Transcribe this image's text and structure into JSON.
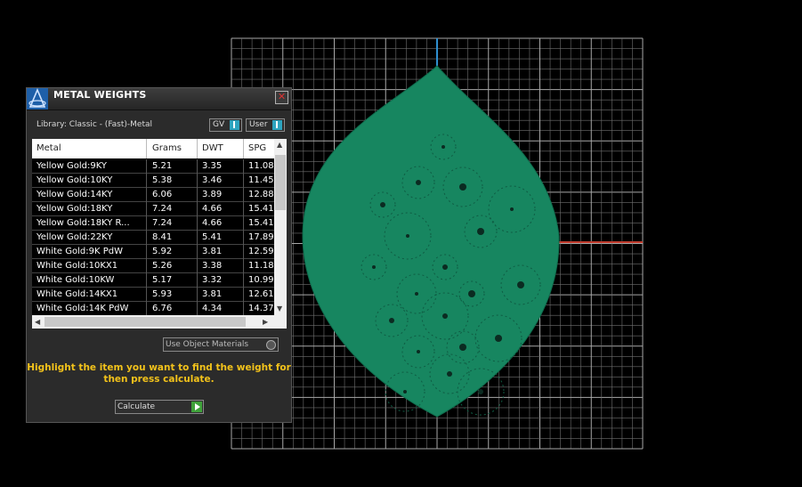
{
  "colors": {
    "background": "#000000",
    "grid": "#8f8f8f",
    "model": "#178660",
    "axis_y": "#2f8fcf",
    "axis_x": "#c0392b",
    "instruction": "#f2c21b",
    "toggle_knob": "#2da4bf",
    "calculate_go": "#3fa13a"
  },
  "panel": {
    "title": "METAL WEIGHTS",
    "close_icon": "close-icon",
    "logo_icon": "app-logo-icon",
    "library_label": "Library: Classic - (Fast)-Metal",
    "toggle_gv": "GV",
    "toggle_user": "User",
    "use_object_materials": "Use Object Materials",
    "instruction": "Highlight the item you want to find the weight for then press calculate.",
    "calculate_label": "Calculate"
  },
  "table": {
    "columns": [
      "Metal",
      "Grams",
      "DWT",
      "SPG"
    ],
    "rows": [
      [
        "Yellow Gold:9KY",
        "5.21",
        "3.35",
        "11.08"
      ],
      [
        "Yellow Gold:10KY",
        "5.38",
        "3.46",
        "11.45"
      ],
      [
        "Yellow Gold:14KY",
        "6.06",
        "3.89",
        "12.88"
      ],
      [
        "Yellow Gold:18KY",
        "7.24",
        "4.66",
        "15.41"
      ],
      [
        "Yellow Gold:18KY R...",
        "7.24",
        "4.66",
        "15.41"
      ],
      [
        "Yellow Gold:22KY",
        "8.41",
        "5.41",
        "17.89"
      ],
      [
        "White Gold:9K PdW",
        "5.92",
        "3.81",
        "12.59"
      ],
      [
        "White Gold:10KX1",
        "5.26",
        "3.38",
        "11.18"
      ],
      [
        "White Gold:10KW",
        "5.17",
        "3.32",
        "10.99"
      ],
      [
        "White Gold:14KX1",
        "5.93",
        "3.81",
        "12.61"
      ],
      [
        "White Gold:14K PdW",
        "6.76",
        "4.34",
        "14.37"
      ]
    ]
  }
}
